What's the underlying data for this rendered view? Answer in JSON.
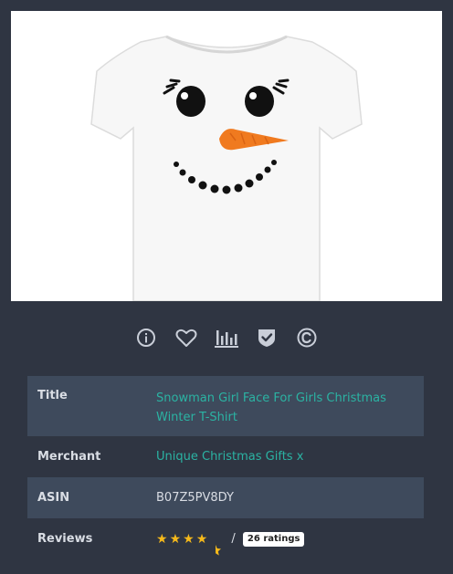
{
  "product": {
    "image_alt": "white t-shirt with snowman girl face"
  },
  "actions": [
    {
      "name": "info-icon"
    },
    {
      "name": "heart-icon"
    },
    {
      "name": "bar-chart-icon"
    },
    {
      "name": "shield-check-icon"
    },
    {
      "name": "copyright-icon"
    }
  ],
  "details": {
    "title_label": "Title",
    "title_value": "Snowman Girl Face For Girls Christmas Winter T-Shirt",
    "merchant_label": "Merchant",
    "merchant_value": "Unique Christmas Gifts x",
    "asin_label": "ASIN",
    "asin_value": "B07Z5PV8DY",
    "reviews_label": "Reviews",
    "rating": 4.5,
    "separator": "/",
    "ratings_count": "26 ratings"
  },
  "colors": {
    "background": "#2f3542",
    "row_shade": "#3e4a5c",
    "link": "#2bb3a3",
    "star": "#f5b91b",
    "icon": "#c9ced8"
  }
}
